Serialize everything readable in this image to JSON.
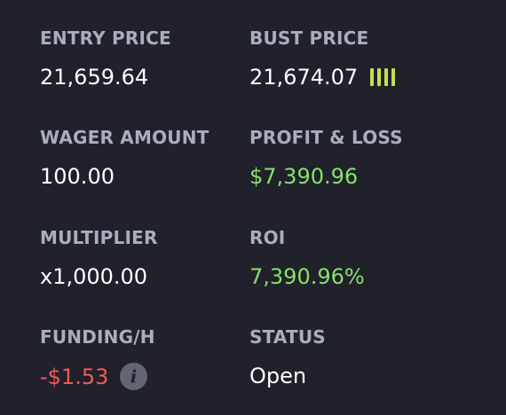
{
  "colors": {
    "background": "#20212b",
    "label": "#a9adbd",
    "value": "#ffffff",
    "positive": "#86e06a",
    "negative": "#ef5b5b",
    "liquidity_bar": "#c2e04e",
    "info_icon_bg": "#636573"
  },
  "entry": {
    "label": "ENTRY PRICE",
    "value": "21,659.64"
  },
  "bust": {
    "label": "BUST PRICE",
    "value": "21,674.07",
    "indicator_icon": "signal-bars-icon",
    "indicator_level": 4
  },
  "wager": {
    "label": "WAGER AMOUNT",
    "value": "100.00"
  },
  "pnl": {
    "label": "PROFIT & LOSS",
    "value": "$7,390.96"
  },
  "multiplier": {
    "label": "MULTIPLIER",
    "value": "x1,000.00"
  },
  "roi": {
    "label": "ROI",
    "value": "7,390.96%"
  },
  "funding": {
    "label": "FUNDING/H",
    "value": "-$1.53",
    "info_icon": "info-icon",
    "info_glyph": "i"
  },
  "status": {
    "label": "STATUS",
    "value": "Open"
  }
}
